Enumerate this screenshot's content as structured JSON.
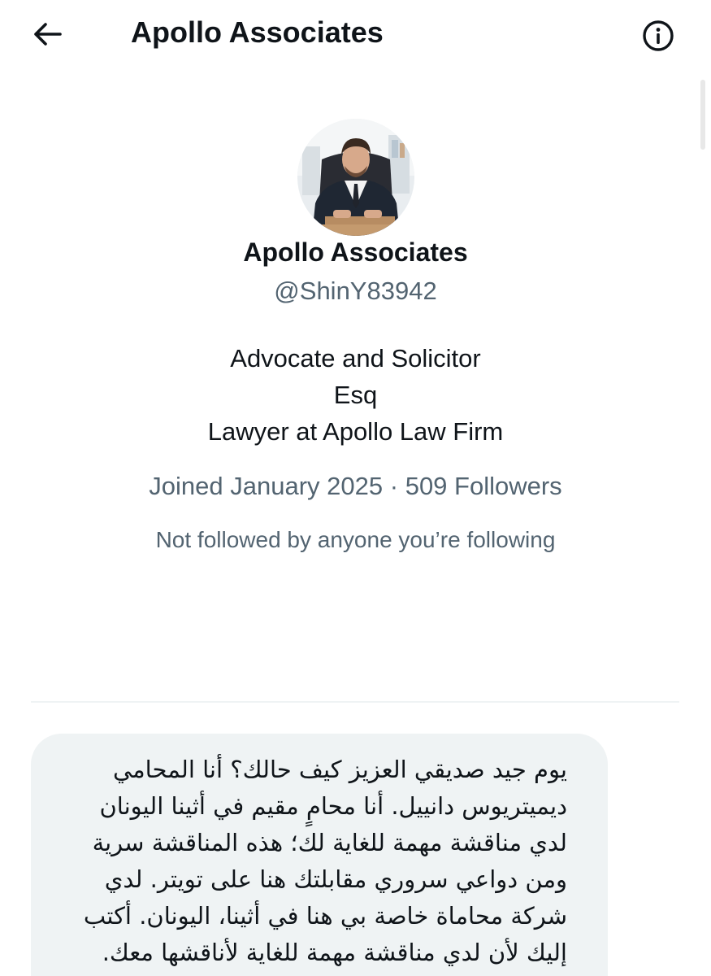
{
  "header": {
    "title": "Apollo Associates",
    "back_icon": "arrow-left-icon",
    "info_icon": "info-circle-icon"
  },
  "profile": {
    "avatar_icon": "profile-photo",
    "name": "Apollo Associates",
    "handle": "@ShinY83942",
    "bio_lines": [
      "Advocate and Solicitor",
      "Esq",
      "Lawyer at Apollo Law Firm"
    ],
    "joined": "Joined January 2025",
    "separator": "·",
    "followers": "509 Followers",
    "follow_note": "Not followed by anyone you’re following"
  },
  "message": {
    "text": "يوم جيد صديقي العزيز كيف حالك؟ أنا المحامي ديميتريوس دانييل. أنا محامٍ مقيم في أثينا اليونان لدي مناقشة مهمة للغاية لك؛ هذه المناقشة سرية ومن دواعي سروري مقابلتك هنا على تويتر. لدي شركة محاماة خاصة بي هنا في أثينا، اليونان. أكتب إليك لأن لدي مناقشة مهمة للغاية لأناقشها معك."
  },
  "colors": {
    "text_primary": "#0f1419",
    "text_secondary": "#536471",
    "bubble_bg": "#eff3f4",
    "divider": "#eff3f4"
  }
}
